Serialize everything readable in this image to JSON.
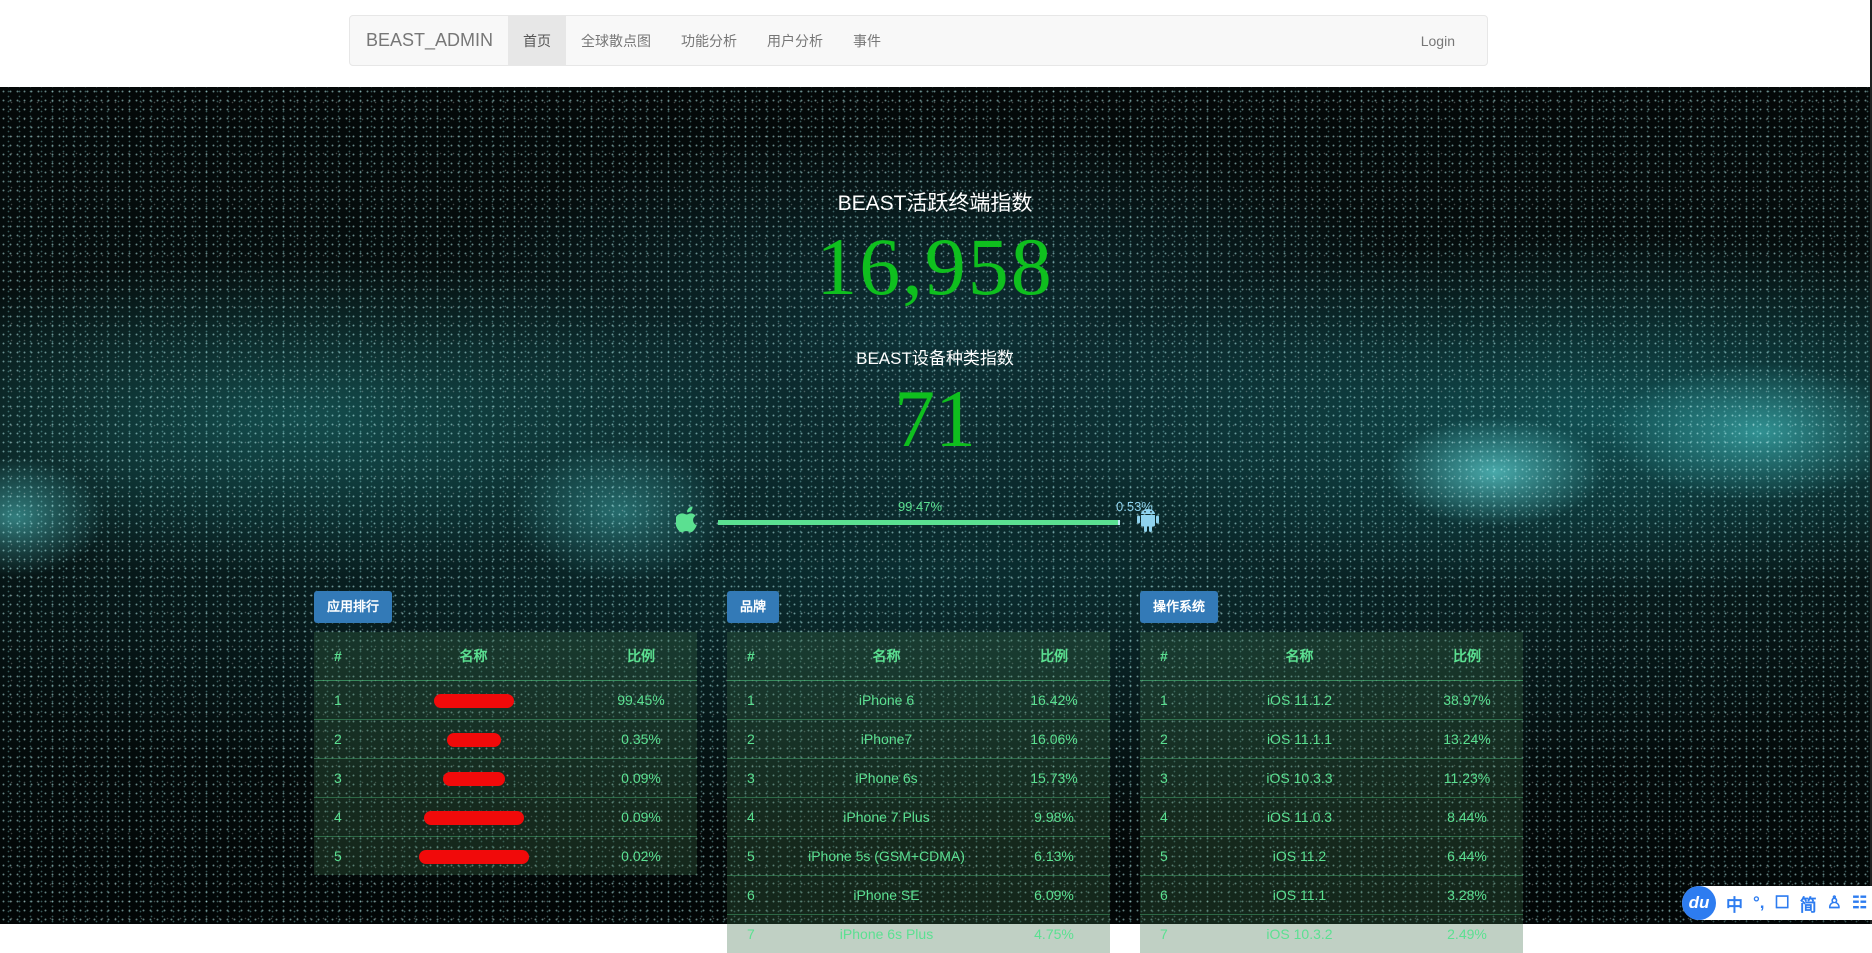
{
  "nav": {
    "brand": "BEAST_ADMIN",
    "items": [
      {
        "label": "首页",
        "active": true
      },
      {
        "label": "全球散点图"
      },
      {
        "label": "功能分析"
      },
      {
        "label": "用户分析"
      },
      {
        "label": "事件"
      }
    ],
    "login": "Login"
  },
  "stats": {
    "active_title": "BEAST活跃终端指数",
    "active_value": "16,958",
    "device_title": "BEAST设备种类指数",
    "device_value": "71"
  },
  "platform": {
    "ios_pct": "99.47%",
    "android_pct": "0.53%",
    "ios_fraction": 0.9947,
    "left_icon": "apple-icon",
    "right_icon": "android-icon"
  },
  "panels": {
    "apps": {
      "title": "应用排行",
      "headers": [
        "#",
        "名称",
        "比例"
      ],
      "rows": [
        {
          "rank": "1",
          "name": "",
          "pct": "99.45%"
        },
        {
          "rank": "2",
          "name": "",
          "pct": "0.35%"
        },
        {
          "rank": "3",
          "name": "",
          "pct": "0.09%"
        },
        {
          "rank": "4",
          "name": "",
          "pct": "0.09%"
        },
        {
          "rank": "5",
          "name": "",
          "pct": "0.02%"
        }
      ]
    },
    "brands": {
      "title": "品牌",
      "headers": [
        "#",
        "名称",
        "比例"
      ],
      "rows": [
        {
          "rank": "1",
          "name": "iPhone 6",
          "pct": "16.42%"
        },
        {
          "rank": "2",
          "name": "iPhone7",
          "pct": "16.06%"
        },
        {
          "rank": "3",
          "name": "iPhone 6s",
          "pct": "15.73%"
        },
        {
          "rank": "4",
          "name": "iPhone 7 Plus",
          "pct": "9.98%"
        },
        {
          "rank": "5",
          "name": "iPhone 5s (GSM+CDMA)",
          "pct": "6.13%"
        },
        {
          "rank": "6",
          "name": "iPhone SE",
          "pct": "6.09%"
        },
        {
          "rank": "7",
          "name": "iPhone 6s Plus",
          "pct": "4.75%"
        }
      ]
    },
    "os": {
      "title": "操作系统",
      "headers": [
        "#",
        "名称",
        "比例"
      ],
      "rows": [
        {
          "rank": "1",
          "name": "iOS 11.1.2",
          "pct": "38.97%"
        },
        {
          "rank": "2",
          "name": "iOS 11.1.1",
          "pct": "13.24%"
        },
        {
          "rank": "3",
          "name": "iOS 10.3.3",
          "pct": "11.23%"
        },
        {
          "rank": "4",
          "name": "iOS 11.0.3",
          "pct": "8.44%"
        },
        {
          "rank": "5",
          "name": "iOS 11.2",
          "pct": "6.44%"
        },
        {
          "rank": "6",
          "name": "iOS 11.1",
          "pct": "3.28%"
        },
        {
          "rank": "7",
          "name": "iOS 10.3.2",
          "pct": "2.49%"
        }
      ]
    }
  },
  "ime": {
    "logo": "du",
    "items": [
      "中",
      "°,",
      "☐",
      "简",
      "♙",
      "☷"
    ]
  }
}
